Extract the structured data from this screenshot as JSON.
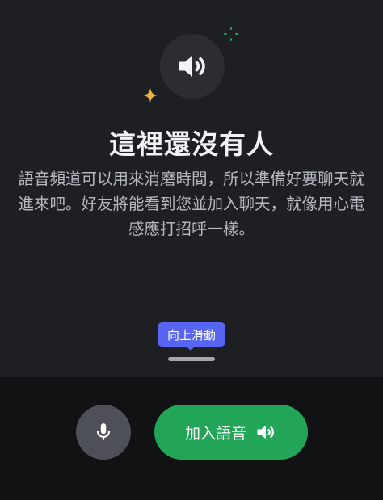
{
  "empty_state": {
    "title": "這裡還沒有人",
    "description_line1": "語音頻道可以用來消磨時間，所以準備好要聊天就",
    "description_line2": "進來吧。好友將能看到您並加入聊天，就像用心電",
    "description_line3": "感應打招呼一樣。"
  },
  "tooltip": {
    "text": "向上滑動"
  },
  "controls": {
    "join_label": "加入語音",
    "mic_icon": "microphone-icon",
    "speaker_icon": "speaker-icon"
  },
  "colors": {
    "background": "#1e1f22",
    "bottom_bar": "#111214",
    "join_green": "#23a559",
    "tooltip_blurple": "#5865f2",
    "sparkle_green": "#23a559",
    "sparkle_yellow": "#f0b232"
  }
}
